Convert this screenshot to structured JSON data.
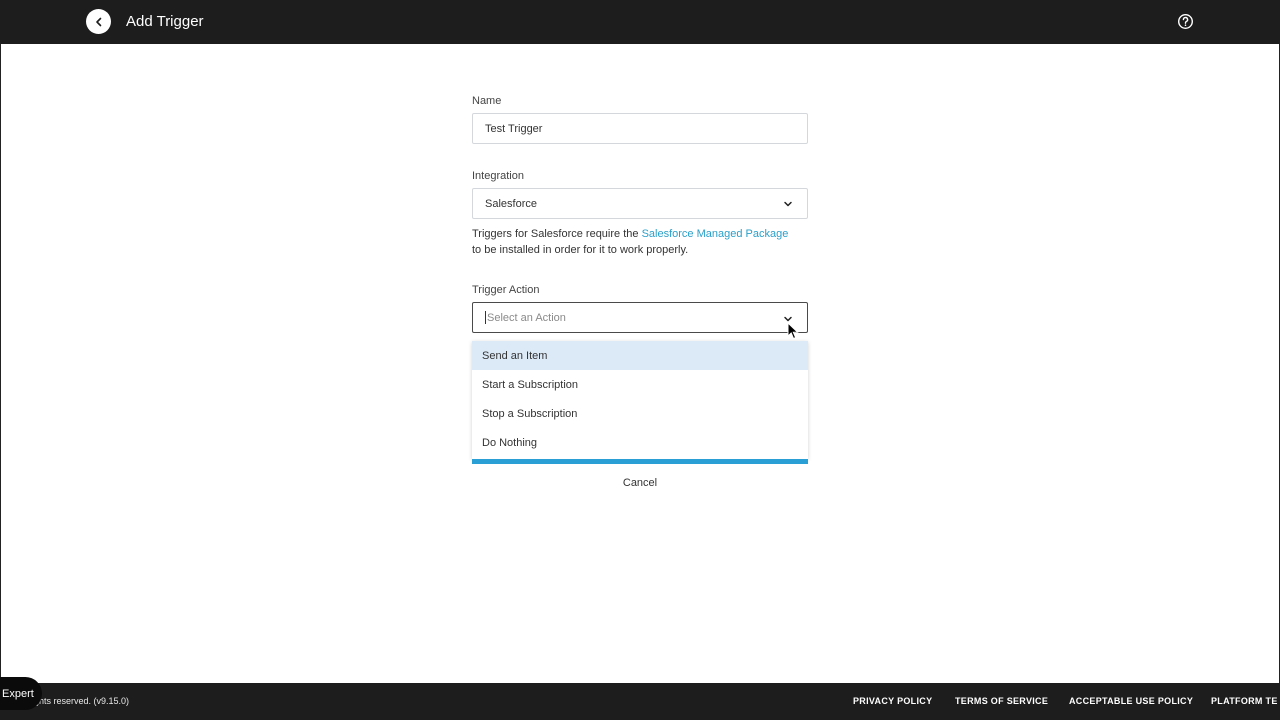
{
  "header": {
    "title": "Add Trigger",
    "back_icon": "chevron-left-icon",
    "help_icon": "question-circle-icon"
  },
  "form": {
    "name": {
      "label": "Name",
      "value": "Test Trigger"
    },
    "integration": {
      "label": "Integration",
      "value": "Salesforce",
      "help_text_before": "Triggers for Salesforce require the ",
      "help_link": "Salesforce Managed Package",
      "help_text_after": "to be installed in order for it to work properly."
    },
    "trigger_action": {
      "label": "Trigger Action",
      "placeholder": "Select an Action",
      "options": [
        "Send an Item",
        "Start a Subscription",
        "Stop a Subscription",
        "Do Nothing"
      ],
      "highlighted": "Send an Item"
    },
    "cancel_label": "Cancel"
  },
  "footer": {
    "copyright": "ghts reserved.  (v9.15.0)",
    "links": [
      "PRIVACY POLICY",
      "TERMS OF SERVICE",
      "ACCEPTABLE USE POLICY",
      "PLATFORM TE"
    ]
  },
  "expert_badge": "Expert",
  "colors": {
    "header_bg": "#1d1d1d",
    "link": "#2a9fc9",
    "highlight": "#dceaf8",
    "accent_bar": "#2a9fd6"
  }
}
